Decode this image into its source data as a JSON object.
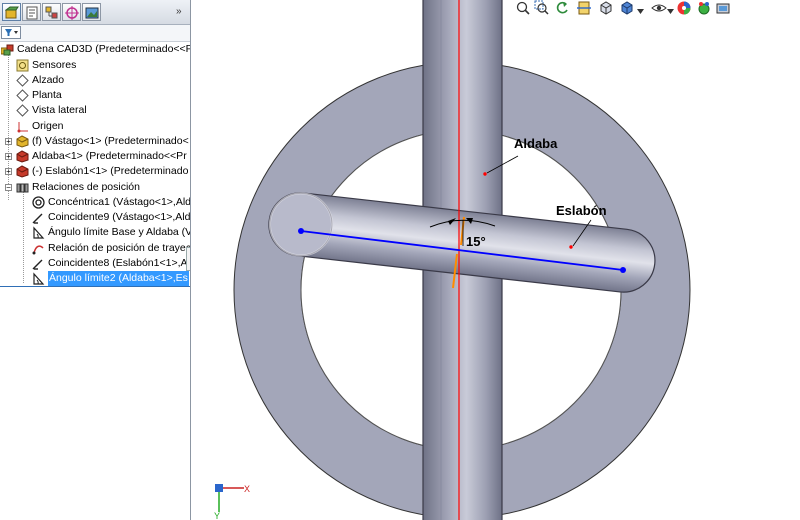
{
  "feature_tree": {
    "root": "Cadena CAD3D  (Predeterminado<<P",
    "items": [
      {
        "label": "Sensores"
      },
      {
        "label": "Alzado"
      },
      {
        "label": "Planta"
      },
      {
        "label": "Vista lateral"
      },
      {
        "label": "Origen"
      },
      {
        "label": "(f) Vástago<1> (Predeterminado<"
      },
      {
        "label": "Aldaba<1> (Predeterminado<<Pr"
      },
      {
        "label": "(-) Eslabón1<1> (Predeterminado"
      },
      {
        "label": "Relaciones de posición"
      }
    ],
    "mates": [
      {
        "label": "Concéntrica1 (Vástago<1>,Ald"
      },
      {
        "label": "Coincidente9 (Vástago<1>,Ald"
      },
      {
        "label": "Ángulo límite Base y Aldaba (V"
      },
      {
        "label": "Relación de posición de trayec"
      },
      {
        "label": "Coincidente8 (Eslabón1<1>,A"
      },
      {
        "label": "Ángulo límite2 (Aldaba<1>,Es"
      }
    ]
  },
  "viewport": {
    "labels": {
      "aldaba": "Aldaba",
      "eslabon": "Eslabón",
      "angle": "15°"
    }
  },
  "colors": {
    "part_fill": "#a3a6b9",
    "selection_blue": "#3399ff",
    "sketch_blue": "#0000ff",
    "axis_red": "#ff0000"
  }
}
